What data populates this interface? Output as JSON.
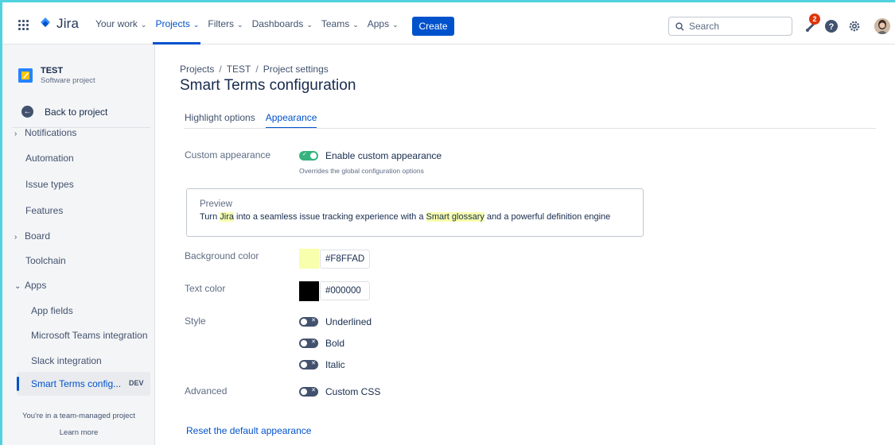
{
  "topnav": {
    "logo_text": "Jira",
    "items": [
      {
        "label": "Your work",
        "active": false
      },
      {
        "label": "Projects",
        "active": true
      },
      {
        "label": "Filters",
        "active": false
      },
      {
        "label": "Dashboards",
        "active": false
      },
      {
        "label": "Teams",
        "active": false
      },
      {
        "label": "Apps",
        "active": false
      }
    ],
    "create_label": "Create",
    "search_placeholder": "Search",
    "notification_count": "2",
    "icons": [
      "app-switcher-icon",
      "jira-logo-icon",
      "search-icon",
      "notification-icon",
      "help-icon",
      "settings-icon",
      "avatar"
    ]
  },
  "sidebar": {
    "project_name": "TEST",
    "project_type": "Software project",
    "back_label": "Back to project",
    "items": [
      {
        "label": "Notifications",
        "expandable": true
      },
      {
        "label": "Automation",
        "expandable": false
      },
      {
        "label": "Issue types",
        "expandable": false
      },
      {
        "label": "Features",
        "expandable": false
      },
      {
        "label": "Board",
        "expandable": true
      },
      {
        "label": "Toolchain",
        "expandable": false
      },
      {
        "label": "Apps",
        "expandable": true,
        "expanded": true
      }
    ],
    "sub_items": [
      {
        "label": "App fields"
      },
      {
        "label": "Microsoft Teams integration"
      },
      {
        "label": "Slack integration"
      }
    ],
    "active_item": {
      "label": "Smart Terms config...",
      "badge": "DEV"
    },
    "footer_text": "You're in a team-managed project",
    "footer_link": "Learn more"
  },
  "main": {
    "breadcrumbs": [
      "Projects",
      "TEST",
      "Project settings"
    ],
    "title": "Smart Terms configuration",
    "tabs": [
      {
        "label": "Highlight options",
        "active": false
      },
      {
        "label": "Appearance",
        "active": true
      }
    ],
    "custom_appearance": {
      "label": "Custom appearance",
      "toggle_label": "Enable custom appearance",
      "enabled": true,
      "help": "Overrides the global configuration options"
    },
    "preview": {
      "label": "Preview",
      "text_before": "Turn ",
      "highlight_1": "Jira",
      "text_mid": " into a seamless issue tracking experience with a ",
      "highlight_2": "Smart glossary",
      "text_after": " and a powerful definition engine"
    },
    "background_color": {
      "label": "Background color",
      "value": "#F8FFAD"
    },
    "text_color": {
      "label": "Text color",
      "value": "#000000"
    },
    "style": {
      "label": "Style",
      "options": [
        {
          "label": "Underlined",
          "enabled": false
        },
        {
          "label": "Bold",
          "enabled": false
        },
        {
          "label": "Italic",
          "enabled": false
        }
      ]
    },
    "advanced": {
      "label": "Advanced",
      "option": "Custom CSS",
      "enabled": false
    },
    "reset_link": "Reset the default appearance"
  },
  "colors": {
    "accent": "#0052CC",
    "toggle_on": "#36B37E",
    "toggle_off": "#42526E",
    "frame": "#4FD3DF"
  }
}
